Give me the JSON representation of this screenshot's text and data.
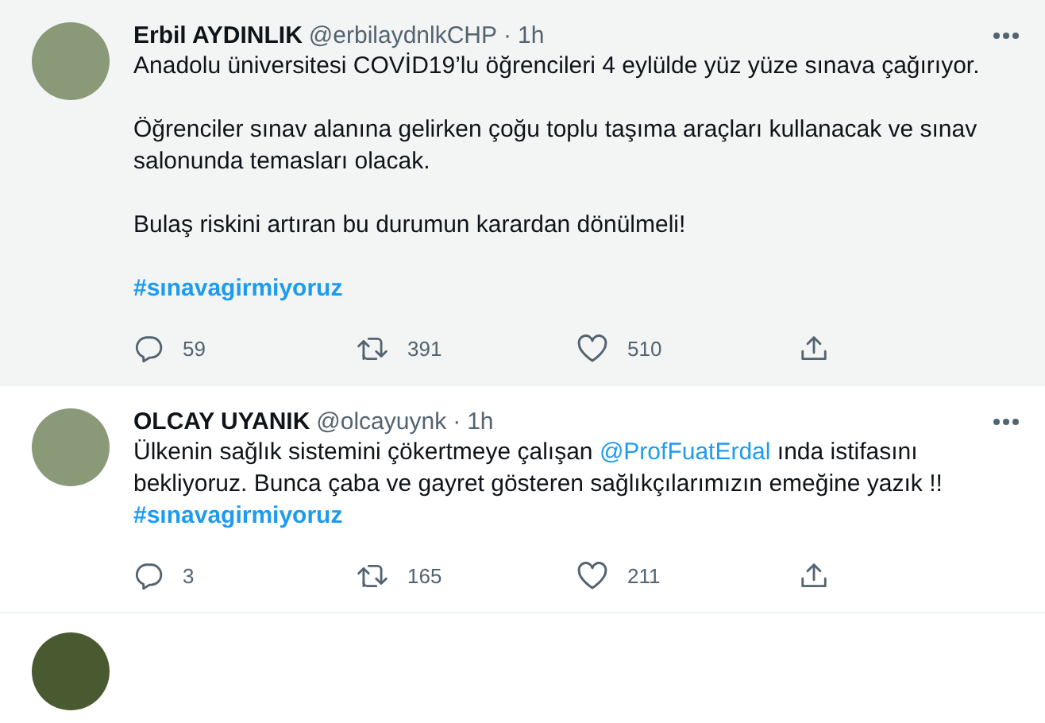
{
  "tweets": [
    {
      "hovered": true,
      "name": "Erbil AYDINLIK",
      "handle": "@erbilaydnlkCHP",
      "separator": "·",
      "time": "1h",
      "paragraphs": [
        [
          {
            "kind": "text",
            "text": "Anadolu üniversitesi COVİD19’lu öğrencileri 4 eylülde yüz yüze sınava çağırıyor."
          }
        ],
        [
          {
            "kind": "text",
            "text": "Öğrenciler sınav alanına gelirken çoğu toplu taşıma araçları kullanacak ve sınav salonunda temasları olacak."
          }
        ],
        [
          {
            "kind": "text",
            "text": "Bulaş riskini artıran bu durumun karardan dönülmeli!"
          }
        ],
        [
          {
            "kind": "link",
            "text": "#sınavagirmiyoruz"
          }
        ]
      ],
      "replies": "59",
      "retweets": "391",
      "likes": "510"
    },
    {
      "hovered": false,
      "name": "OLCAY UYANIK",
      "handle": "@olcayuynk",
      "separator": "·",
      "time": "1h",
      "paragraphs": [
        [
          {
            "kind": "text",
            "text": "Ülkenin sağlık sistemini çökertmeye çalışan "
          },
          {
            "kind": "link",
            "text": "@ProfFuatErdal"
          },
          {
            "kind": "text",
            "text": " ında istifasını bekliyoruz. Bunca çaba ve gayret gösteren sağlıkçılarımızın emeğine yazık !!"
          },
          {
            "kind": "break"
          },
          {
            "kind": "link",
            "text": "#sınavagirmiyoruz"
          }
        ]
      ],
      "replies": "3",
      "retweets": "165",
      "likes": "211"
    }
  ]
}
